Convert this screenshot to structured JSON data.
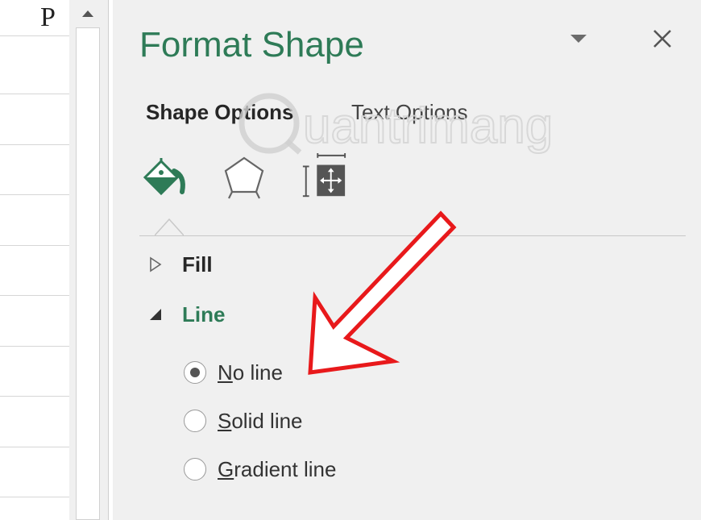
{
  "sheet": {
    "column_label": "P"
  },
  "pane": {
    "title": "Format Shape",
    "tabs": [
      {
        "label": "Shape Options",
        "active": true
      },
      {
        "label": "Text Options",
        "active": false
      }
    ],
    "icons": [
      "fill-line-icon",
      "effects-icon",
      "size-properties-icon"
    ],
    "sections": {
      "fill": {
        "label": "Fill",
        "expanded": false
      },
      "line": {
        "label": "Line",
        "expanded": true,
        "options": [
          {
            "access_key": "N",
            "rest": "o line",
            "selected": true
          },
          {
            "access_key": "S",
            "rest": "olid line",
            "selected": false
          },
          {
            "access_key": "G",
            "rest": "radient line",
            "selected": false
          }
        ]
      }
    }
  },
  "watermark": {
    "text": "uantrimang"
  },
  "colors": {
    "accent": "#2e7b57",
    "pane_bg": "#f0f0f0",
    "arrow": "#e8191b"
  }
}
